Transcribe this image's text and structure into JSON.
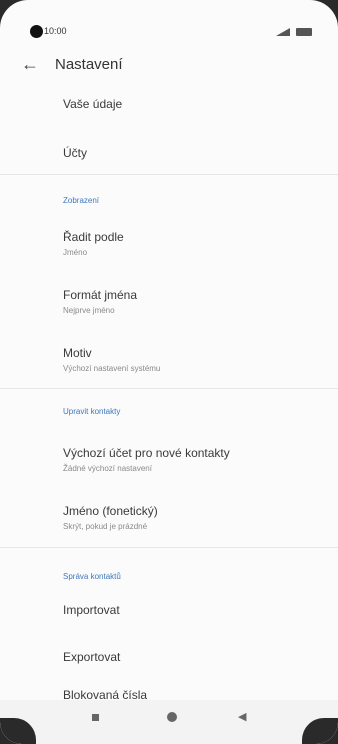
{
  "status": {
    "time": "10:00"
  },
  "appbar": {
    "title": "Nastavení"
  },
  "items": {
    "vase_udaje": "Vaše údaje",
    "ucty": "Účty"
  },
  "section_display": {
    "header": "Zobrazení",
    "sort_by": {
      "label": "Řadit podle",
      "value": "Jméno"
    },
    "name_format": {
      "label": "Formát jména",
      "value": "Nejprve jméno"
    },
    "theme": {
      "label": "Motiv",
      "value": "Výchozí nastavení systému"
    }
  },
  "section_edit": {
    "header": "Upravit kontakty",
    "default_account": {
      "label": "Výchozí účet pro nové kontakty",
      "value": "Žádné výchozí nastavení"
    },
    "phonetic_name": {
      "label": "Jméno (fonetický)",
      "value": "Skrýt, pokud je prázdné"
    }
  },
  "section_manage": {
    "header": "Správa kontaktů",
    "import": "Importovat",
    "export": "Exportovat",
    "blocked": "Blokovaná čísla"
  }
}
